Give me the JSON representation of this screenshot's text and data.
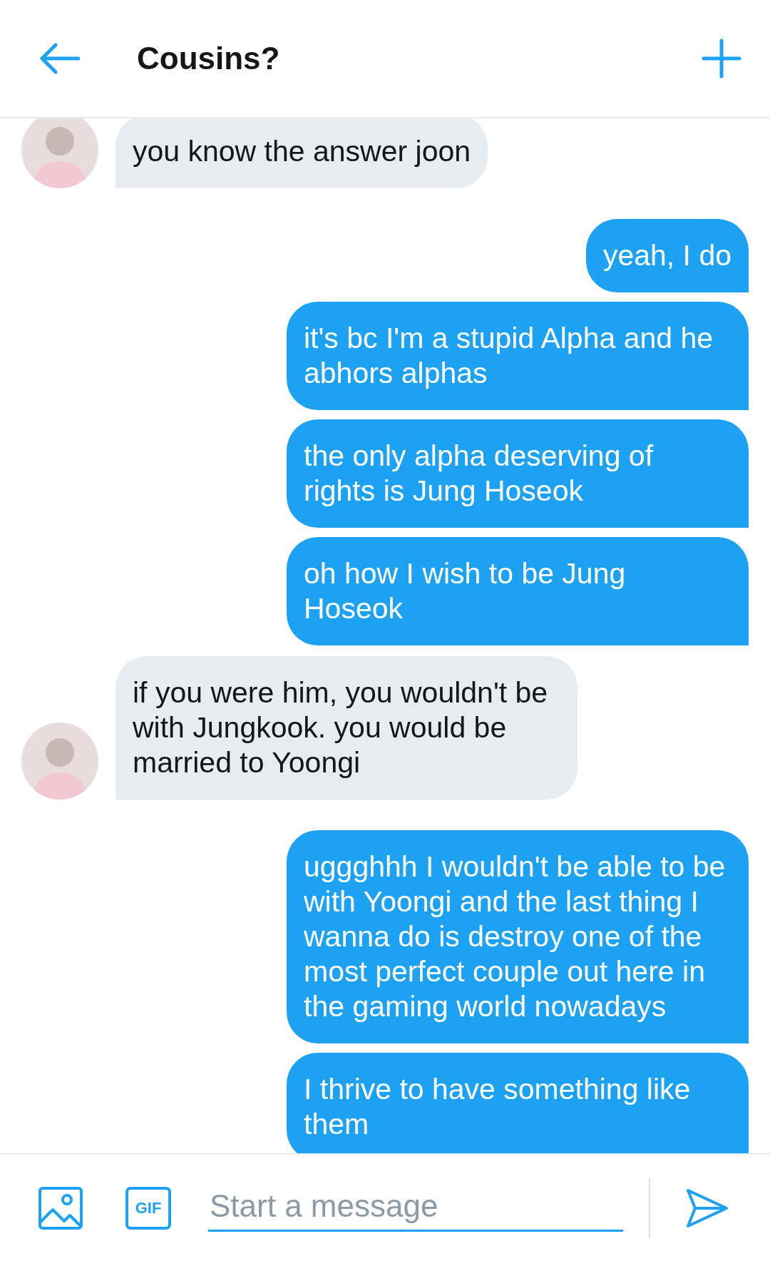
{
  "header": {
    "title": "Cousins?"
  },
  "messages": [
    {
      "kind": "received",
      "lines": [
        "you know the answer joon"
      ]
    },
    {
      "kind": "sent",
      "lines": [
        "yeah, I do"
      ]
    },
    {
      "kind": "sent",
      "lines": [
        "it's bc I'm a stupid Alpha and he",
        "abhors alphas"
      ]
    },
    {
      "kind": "sent",
      "lines": [
        "the only alpha deserving of",
        "rights is Jung Hoseok"
      ]
    },
    {
      "kind": "sent",
      "lines": [
        "oh how I wish to be Jung",
        "Hoseok"
      ]
    },
    {
      "kind": "received",
      "lines": [
        "if you were him, you wouldn't be",
        "with Jungkook. you would be",
        "married to Yoongi"
      ]
    },
    {
      "kind": "sent",
      "lines": [
        "uggghhh I wouldn't be able to be",
        "with Yoongi and the last thing I",
        "wanna do is destroy one of the",
        "most perfect couple out here in",
        "the gaming world nowadays"
      ]
    },
    {
      "kind": "sent",
      "lines": [
        "I thrive to have something like",
        "them"
      ]
    }
  ],
  "composer": {
    "gif_label": "GIF",
    "placeholder": "Start a message"
  }
}
